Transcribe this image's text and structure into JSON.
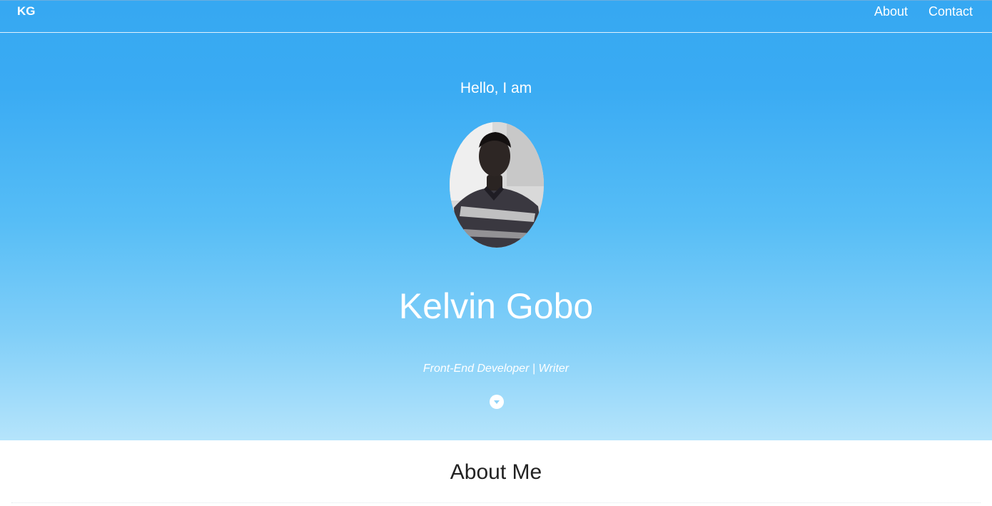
{
  "nav": {
    "brand": "KG",
    "links": [
      "About",
      "Contact"
    ]
  },
  "hero": {
    "greeting": "Hello, I am",
    "name": "Kelvin Gobo",
    "tagline": "Front-End Developer | Writer",
    "scroll_icon": "chevron-down-icon"
  },
  "about": {
    "title": "About Me"
  },
  "colors": {
    "hero_top": "#36a8f2",
    "hero_bottom": "#b5e4fb",
    "text_light": "#ffffff",
    "text_dark": "#222222"
  }
}
